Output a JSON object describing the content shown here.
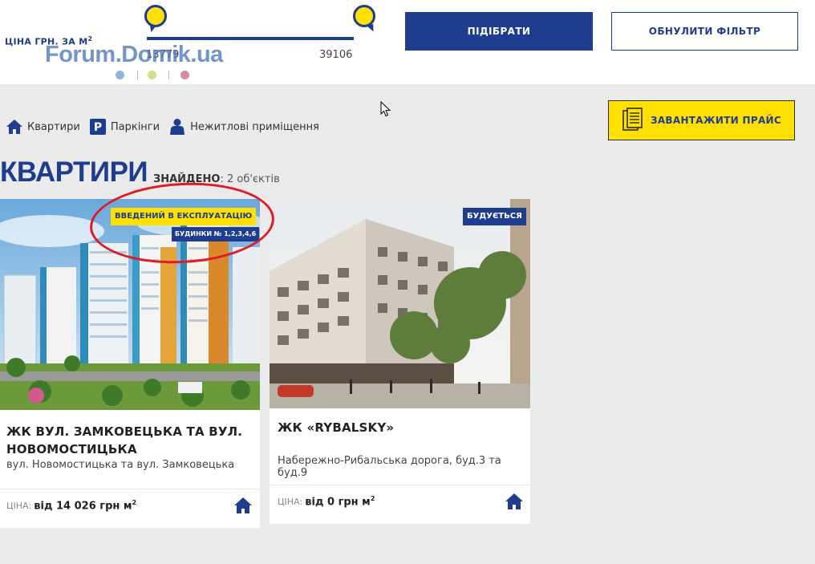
{
  "filter": {
    "price_label": "ЦІНА ГРН. ЗА М",
    "price_unit_sup": "2",
    "slider_min": "13779",
    "slider_max": "39106",
    "select_button": "ПІДІБРАТИ",
    "reset_button": "ОБНУЛИТИ ФІЛЬТР"
  },
  "watermark": {
    "text": "Forum.Domik.ua",
    "dot_colors": [
      "#8fb3d9",
      "#d8dc8a",
      "#d98aa4"
    ]
  },
  "categories": [
    {
      "label": "Квартири",
      "icon": "house-icon"
    },
    {
      "label": "Паркінги",
      "icon": "parking-icon"
    },
    {
      "label": "Нежитлові приміщення",
      "icon": "person-icon"
    }
  ],
  "download_button": "ЗАВАНТАЖИТИ ПРАЙС",
  "section_title": "КВАРТИРИ",
  "found": {
    "label": "ЗНАЙДЕНО",
    "text": ": 2 об'єктів"
  },
  "cards": [
    {
      "title": "ЖК ВУЛ. ЗАМКОВЕЦЬКА ТА ВУЛ. НОВОМОСТИЦЬКА",
      "address": "вул. Новомостицька та вул. Замковецька",
      "price_label": "ЦІНА:",
      "price_value": "від 14 026 грн м",
      "price_sup": "2",
      "status_badge": "ВВЕДЕНИЙ В ЕКСПЛУАТАЦІЮ",
      "buildings_badge": "БУДИНКИ № 1,2,3,4,6"
    },
    {
      "title": "ЖК «RYBALSKY»",
      "address": "Набережно-Рибальська дорога, буд.3 та буд.9",
      "price_label": "ЦІНА:",
      "price_value": "від 0 грн м",
      "price_sup": "2",
      "status_badge": "БУДУЄТЬСЯ"
    }
  ],
  "colors": {
    "brand_blue": "#1f3d8f",
    "accent_yellow": "#ffe000",
    "annotation_red": "#e01b24",
    "page_bg": "#ebebeb"
  }
}
